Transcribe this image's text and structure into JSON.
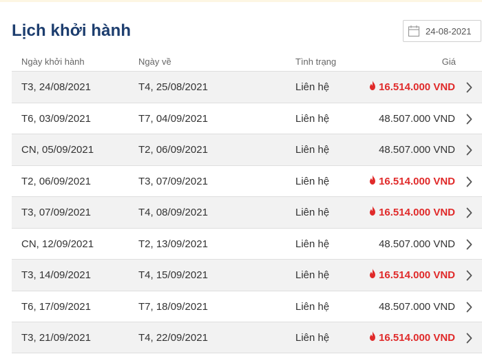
{
  "header": {
    "title": "Lịch khởi hành",
    "date_value": "24-08-2021"
  },
  "columns": {
    "departure": "Ngày khởi hành",
    "return": "Ngày về",
    "status": "Tình trạng",
    "price": "Giá"
  },
  "colors": {
    "title": "#1c3d6e",
    "hot_price": "#e02a2a",
    "row_shade": "#f2f2f2"
  },
  "rows": [
    {
      "departure": "T3, 24/08/2021",
      "return": "T4, 25/08/2021",
      "status": "Liên hệ",
      "price": "16.514.000 VND",
      "hot": true
    },
    {
      "departure": "T6, 03/09/2021",
      "return": "T7, 04/09/2021",
      "status": "Liên hệ",
      "price": "48.507.000 VND",
      "hot": false
    },
    {
      "departure": "CN, 05/09/2021",
      "return": "T2, 06/09/2021",
      "status": "Liên hệ",
      "price": "48.507.000 VND",
      "hot": false
    },
    {
      "departure": "T2, 06/09/2021",
      "return": "T3, 07/09/2021",
      "status": "Liên hệ",
      "price": "16.514.000 VND",
      "hot": true
    },
    {
      "departure": "T3, 07/09/2021",
      "return": "T4, 08/09/2021",
      "status": "Liên hệ",
      "price": "16.514.000 VND",
      "hot": true
    },
    {
      "departure": "CN, 12/09/2021",
      "return": "T2, 13/09/2021",
      "status": "Liên hệ",
      "price": "48.507.000 VND",
      "hot": false
    },
    {
      "departure": "T3, 14/09/2021",
      "return": "T4, 15/09/2021",
      "status": "Liên hệ",
      "price": "16.514.000 VND",
      "hot": true
    },
    {
      "departure": "T6, 17/09/2021",
      "return": "T7, 18/09/2021",
      "status": "Liên hệ",
      "price": "48.507.000 VND",
      "hot": false
    },
    {
      "departure": "T3, 21/09/2021",
      "return": "T4, 22/09/2021",
      "status": "Liên hệ",
      "price": "16.514.000 VND",
      "hot": true
    }
  ]
}
